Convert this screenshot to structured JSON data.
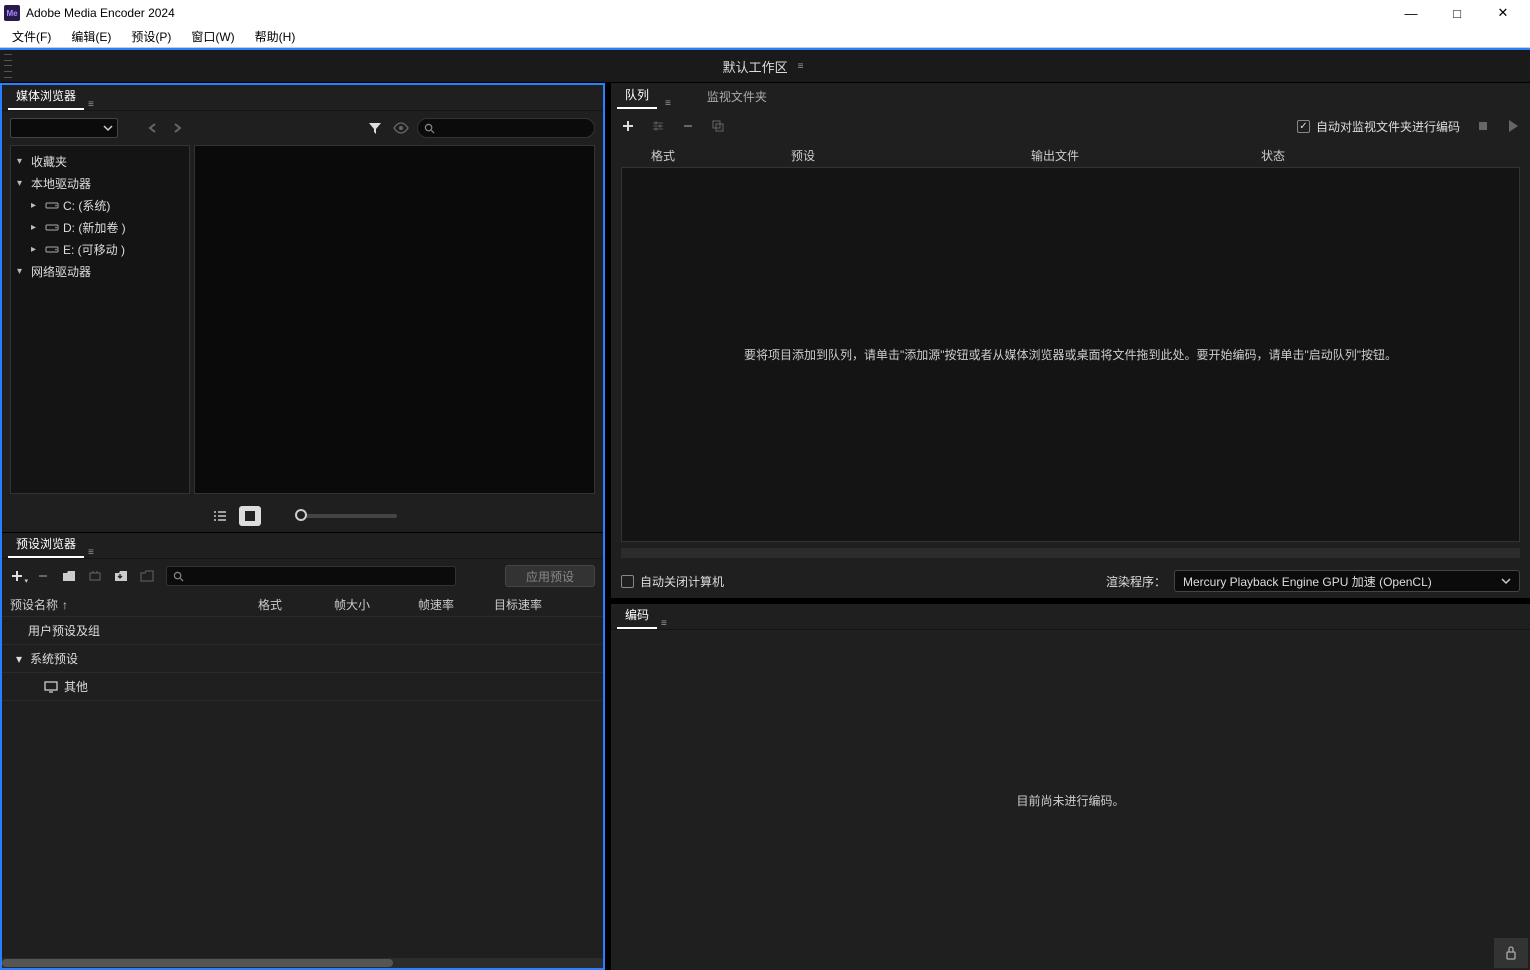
{
  "titlebar": {
    "title": "Adobe Media Encoder 2024",
    "icon": "Me"
  },
  "menubar": [
    "文件(F)",
    "编辑(E)",
    "预设(P)",
    "窗口(W)",
    "帮助(H)"
  ],
  "workspace": {
    "label": "默认工作区"
  },
  "mediaBrowser": {
    "tab": "媒体浏览器",
    "tree": {
      "favorites": "收藏夹",
      "localDrives": "本地驱动器",
      "drives": [
        {
          "label": "C: (系统)"
        },
        {
          "label": "D: (新加卷 )"
        },
        {
          "label": "E: (可移动 )"
        }
      ],
      "networkDrives": "网络驱动器"
    }
  },
  "presetBrowser": {
    "tab": "预设浏览器",
    "applyBtn": "应用预设",
    "columns": {
      "name": "预设名称",
      "format": "格式",
      "frameSize": "帧大小",
      "frameRate": "帧速率",
      "targetRate": "目标速率"
    },
    "rows": {
      "userGroup": "用户预设及组",
      "systemPresets": "系统预设",
      "other": "其他"
    }
  },
  "queue": {
    "tabs": {
      "queue": "队列",
      "watch": "监视文件夹"
    },
    "autoEncode": "自动对监视文件夹进行编码",
    "columns": {
      "format": "格式",
      "preset": "预设",
      "output": "输出文件",
      "status": "状态"
    },
    "dropHint": "要将项目添加到队列，请单击\"添加源\"按钮或者从媒体浏览器或桌面将文件拖到此处。要开始编码，请单击\"启动队列\"按钮。",
    "autoShutdown": "自动关闭计算机",
    "renderLabel": "渲染程序：",
    "renderValue": "Mercury Playback Engine GPU 加速 (OpenCL)"
  },
  "encoding": {
    "tab": "编码",
    "message": "目前尚未进行编码。"
  }
}
